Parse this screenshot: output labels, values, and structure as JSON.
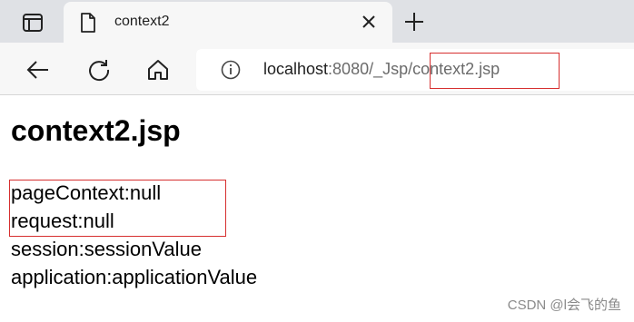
{
  "browser": {
    "tab": {
      "title": "context2"
    },
    "address_bar": {
      "host": "localhost",
      "path": ":8080/_Jsp/context2.jsp"
    }
  },
  "page": {
    "title": "context2.jsp",
    "lines": [
      "pageContext:null",
      "request:null",
      "session:sessionValue",
      "application:applicationValue"
    ]
  },
  "watermark": "CSDN @l会飞的鱼",
  "icons": {
    "tab_actions": "tab-actions-icon",
    "favicon": "page-icon",
    "close": "close-icon",
    "new_tab": "plus-icon",
    "back": "back-arrow-icon",
    "reload": "reload-icon",
    "home": "home-icon",
    "info": "info-icon"
  },
  "colors": {
    "highlight": "#d62f2f",
    "tabstrip": "#dfe1e5",
    "toolbar": "#f7f7f7"
  }
}
